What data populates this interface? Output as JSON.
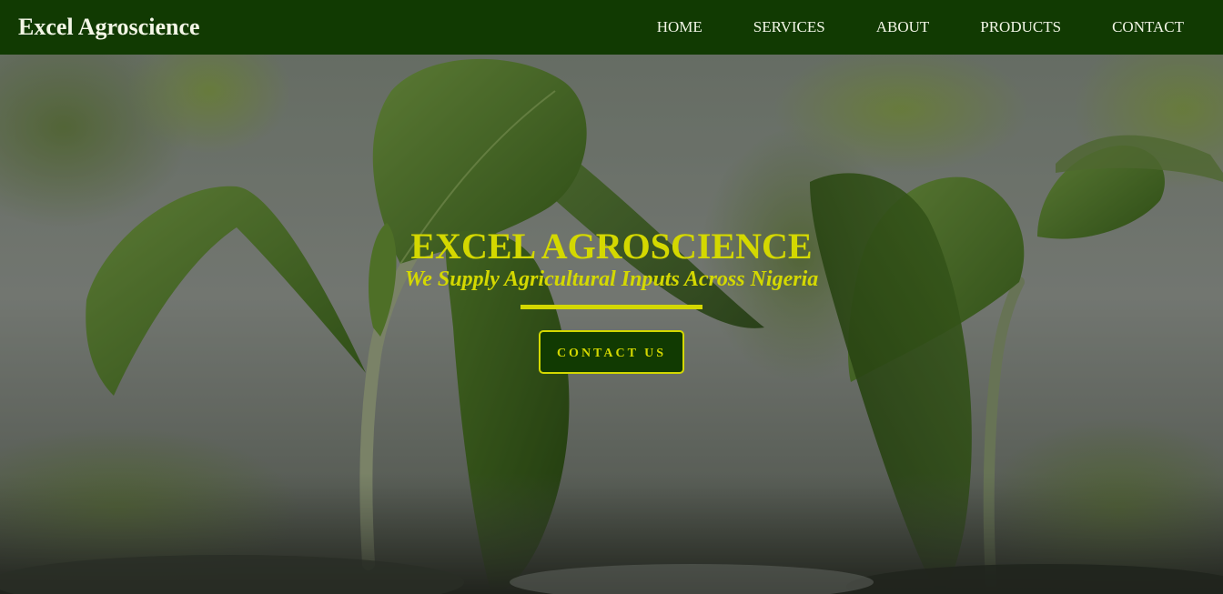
{
  "brand": {
    "name": "Excel Agroscience"
  },
  "nav": {
    "items": [
      "HOME",
      "SERVICES",
      "ABOUT",
      "PRODUCTS",
      "CONTACT"
    ]
  },
  "hero": {
    "title": "EXCEL AGROSCIENCE",
    "subtitle": "We Supply Agricultural Inputs Across Nigeria",
    "cta_label": "CONTACT US"
  },
  "colors": {
    "nav_background": "#113a02",
    "accent": "#d4d800",
    "nav_text": "#f3f6e6"
  }
}
